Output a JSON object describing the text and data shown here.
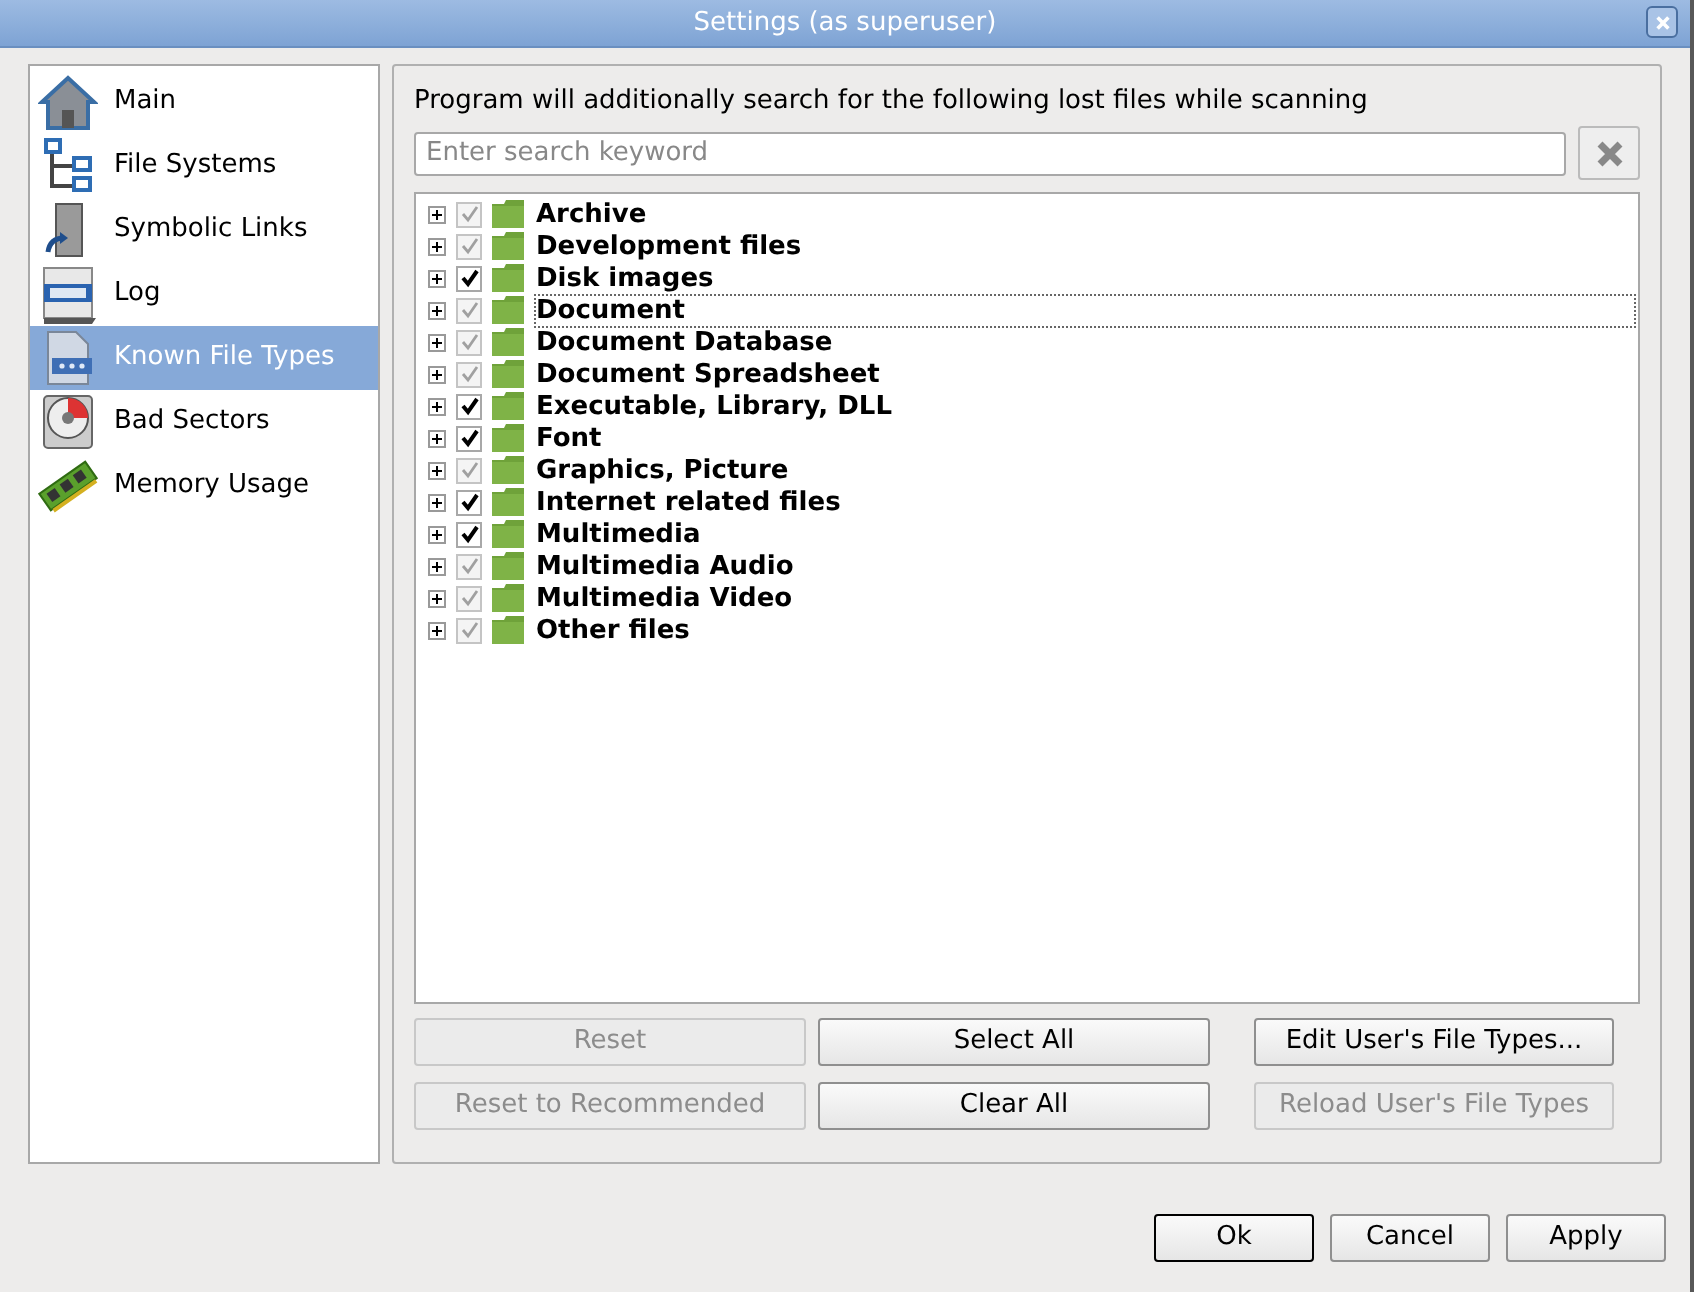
{
  "window": {
    "title": "Settings (as superuser)"
  },
  "sidebar": {
    "items": [
      {
        "label": "Main",
        "selected": false
      },
      {
        "label": "File Systems",
        "selected": false
      },
      {
        "label": "Symbolic Links",
        "selected": false
      },
      {
        "label": "Log",
        "selected": false
      },
      {
        "label": "Known File Types",
        "selected": true
      },
      {
        "label": "Bad Sectors",
        "selected": false
      },
      {
        "label": "Memory Usage",
        "selected": false
      }
    ]
  },
  "panel": {
    "description": "Program will additionally search for the following lost files while scanning",
    "search": {
      "placeholder": "Enter search keyword"
    },
    "tree": [
      {
        "label": "Archive",
        "checked": true,
        "disabled": true,
        "focused": false
      },
      {
        "label": "Development files",
        "checked": true,
        "disabled": true,
        "focused": false
      },
      {
        "label": "Disk images",
        "checked": true,
        "disabled": false,
        "focused": false
      },
      {
        "label": "Document",
        "checked": true,
        "disabled": true,
        "focused": true
      },
      {
        "label": "Document Database",
        "checked": true,
        "disabled": true,
        "focused": false
      },
      {
        "label": "Document Spreadsheet",
        "checked": true,
        "disabled": true,
        "focused": false
      },
      {
        "label": "Executable, Library, DLL",
        "checked": true,
        "disabled": false,
        "focused": false
      },
      {
        "label": "Font",
        "checked": true,
        "disabled": false,
        "focused": false
      },
      {
        "label": "Graphics, Picture",
        "checked": true,
        "disabled": true,
        "focused": false
      },
      {
        "label": "Internet related files",
        "checked": true,
        "disabled": false,
        "focused": false
      },
      {
        "label": "Multimedia",
        "checked": true,
        "disabled": false,
        "focused": false
      },
      {
        "label": "Multimedia Audio",
        "checked": true,
        "disabled": true,
        "focused": false
      },
      {
        "label": "Multimedia Video",
        "checked": true,
        "disabled": true,
        "focused": false
      },
      {
        "label": "Other files",
        "checked": true,
        "disabled": true,
        "focused": false
      }
    ],
    "buttons": [
      {
        "label": "Reset",
        "disabled": true
      },
      {
        "label": "Select All",
        "disabled": false
      },
      {
        "label": "Edit User's File Types...",
        "disabled": false
      },
      {
        "label": "Reset to Recommended",
        "disabled": true
      },
      {
        "label": "Clear All",
        "disabled": false
      },
      {
        "label": "Reload User's File Types",
        "disabled": true
      }
    ]
  },
  "footer": {
    "buttons": [
      {
        "label": "Ok",
        "default": true
      },
      {
        "label": "Cancel",
        "default": false
      },
      {
        "label": "Apply",
        "default": false
      }
    ]
  }
}
